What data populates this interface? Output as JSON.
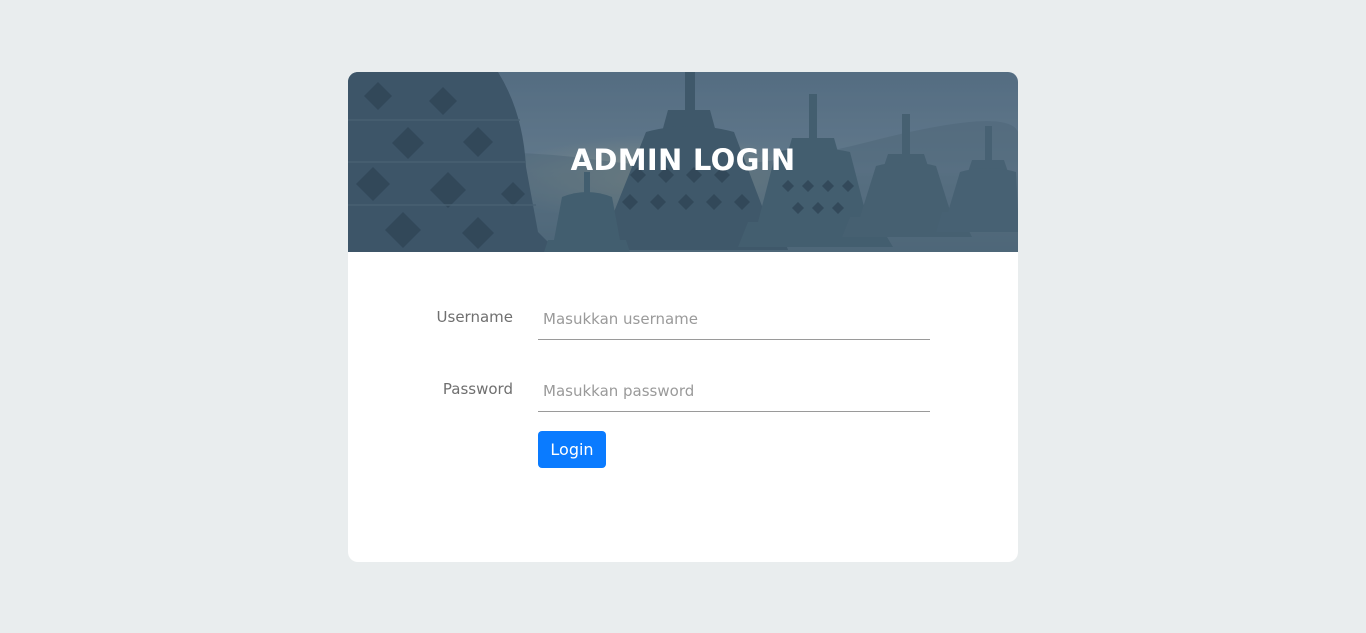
{
  "header": {
    "title": "ADMIN LOGIN"
  },
  "form": {
    "username": {
      "label": "Username",
      "placeholder": "Masukkan username",
      "value": ""
    },
    "password": {
      "label": "Password",
      "placeholder": "Masukkan password",
      "value": ""
    },
    "submit_label": "Login"
  },
  "colors": {
    "page_background": "#e9edee",
    "card_background": "#ffffff",
    "button": "#0a7bff",
    "banner_overlay": "#3e5870"
  }
}
